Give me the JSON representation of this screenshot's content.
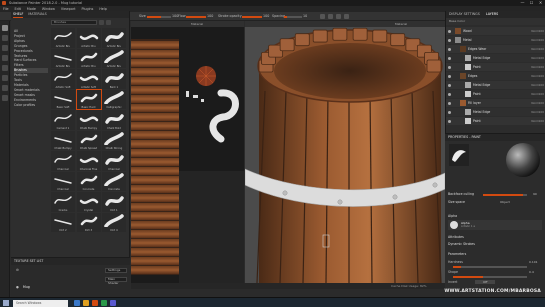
{
  "window": {
    "title": "Substance Painter 2018.2.0 - Mug tutorial",
    "controls": [
      "—",
      "☐",
      "✕"
    ]
  },
  "menu": [
    "File",
    "Edit",
    "Mode",
    "Window",
    "Viewport",
    "Plugins",
    "Help"
  ],
  "toolbar": {
    "size_label": "Size",
    "size_value": "100",
    "flow_label": "Flow",
    "flow_value": "100",
    "stroke_label": "Stroke opacity",
    "stroke_value": "100",
    "spacing_label": "Spacing",
    "spacing_value": "10"
  },
  "shelf": {
    "tabs": [
      "SHELF",
      "MATERIALS"
    ],
    "search_placeholder": "Brushes",
    "categories": [
      "All",
      "Project",
      "Alphas",
      "Grunges",
      "Procedurals",
      "Textures",
      "Hard Surfaces",
      "Filters",
      "Brushes",
      "Particles",
      "Tools",
      "Materials",
      "Smart materials",
      "Smart masks",
      "Environments",
      "Color profiles"
    ],
    "active_category": 8,
    "brushes": [
      {
        "name": "Artistic Bru"
      },
      {
        "name": "Artistic Bru"
      },
      {
        "name": "Artistic Bru"
      },
      {
        "name": "Artistic Bru"
      },
      {
        "name": "Artistic Bru"
      },
      {
        "name": "Artistic Bru"
      },
      {
        "name": "Artistic Soft"
      },
      {
        "name": "Artistic Soft"
      },
      {
        "name": "Bark 1"
      },
      {
        "name": "Basic Soft"
      },
      {
        "name": "Basic Hard"
      },
      {
        "name": "Calligraphic"
      },
      {
        "name": "Cement 1"
      },
      {
        "name": "Chalk Bumpy"
      },
      {
        "name": "Chalk Bold"
      },
      {
        "name": "Chalk Bumpy"
      },
      {
        "name": "Chalk Spread"
      },
      {
        "name": "Chalk Strong"
      },
      {
        "name": "Charcoal"
      },
      {
        "name": "Charcoal Fine"
      },
      {
        "name": "Charcoal"
      },
      {
        "name": "Charcoal"
      },
      {
        "name": "Concrete"
      },
      {
        "name": "Concrete"
      },
      {
        "name": "Cracks"
      },
      {
        "name": "Crystal"
      },
      {
        "name": "Dirt 1"
      },
      {
        "name": "Dirt 2"
      },
      {
        "name": "Dirt 3"
      },
      {
        "name": "Dirt 4"
      }
    ],
    "selected_brush": 10,
    "bottom_title": "TEXTURE SET LIST",
    "settings_label": "Settings",
    "material_label": "Main shader",
    "mode_label": "Main Shader",
    "textureset_name": "Mug"
  },
  "viewports": {
    "v2d_mode": "Material",
    "v3d_mode": "Material",
    "status": "Cache Disk Usage: 82%"
  },
  "layers": {
    "tabs": [
      "DISPLAY SETTINGS",
      "LAYERS"
    ],
    "tool_label": "Base Color",
    "items": [
      {
        "name": "Wood",
        "blend": "Norm",
        "op": "100",
        "thumb": "#7a4a2a",
        "indent": 0
      },
      {
        "name": "Metal",
        "blend": "Norm",
        "op": "100",
        "thumb": "#8a8a8a",
        "indent": 0
      },
      {
        "name": "Edges Wear",
        "blend": "Norm",
        "op": "100",
        "thumb": "#5a3a22",
        "indent": 1
      },
      {
        "name": "Metal Edge",
        "blend": "Norm",
        "op": "100",
        "thumb": "#aaaaaa",
        "indent": 2
      },
      {
        "name": "Paint",
        "blend": "Norm",
        "op": "100",
        "thumb": "#cccccc",
        "indent": 2
      },
      {
        "name": "Edges",
        "blend": "Norm",
        "op": "100",
        "thumb": "#6b4528",
        "indent": 1
      },
      {
        "name": "Metal Edge",
        "blend": "Norm",
        "op": "100",
        "thumb": "#aaaaaa",
        "indent": 2
      },
      {
        "name": "Paint",
        "blend": "Norm",
        "op": "100",
        "thumb": "#cccccc",
        "indent": 2
      },
      {
        "name": "Fill layer",
        "blend": "Norm",
        "op": "100",
        "thumb": "#9a5a30",
        "indent": 1
      },
      {
        "name": "Metal Edge",
        "blend": "Norm",
        "op": "100",
        "thumb": "#aaaaaa",
        "indent": 2
      },
      {
        "name": "Paint",
        "blend": "Norm",
        "op": "100",
        "thumb": "#cccccc",
        "indent": 2
      }
    ]
  },
  "properties": {
    "title": "PROPERTIES - PAINT",
    "backface_label": "Backface culling",
    "backface_value": "90",
    "size_space_label": "Size space",
    "size_space_value": "Object",
    "alpha_section": "Alpha",
    "alpha_name": "Alpha",
    "alpha_sub": "Artistic 1 a",
    "attributes_label": "Attributes",
    "dynamic_label": "Dynamic Strokes",
    "params_label": "Parameters",
    "hardness_label": "Hardness",
    "hardness_value": "0.101",
    "shape_label": "Shape",
    "shape_value": "0.4",
    "invert_label": "Invert",
    "invert_value": "Off"
  },
  "taskbar": {
    "search_placeholder": "Search Windows"
  },
  "watermark": "WWW.ARTSTATION.COM/MBARBOSA",
  "colors": {
    "accent": "#d24a10",
    "wood": "#8a4f2a",
    "metal": "#d9d9d9"
  }
}
